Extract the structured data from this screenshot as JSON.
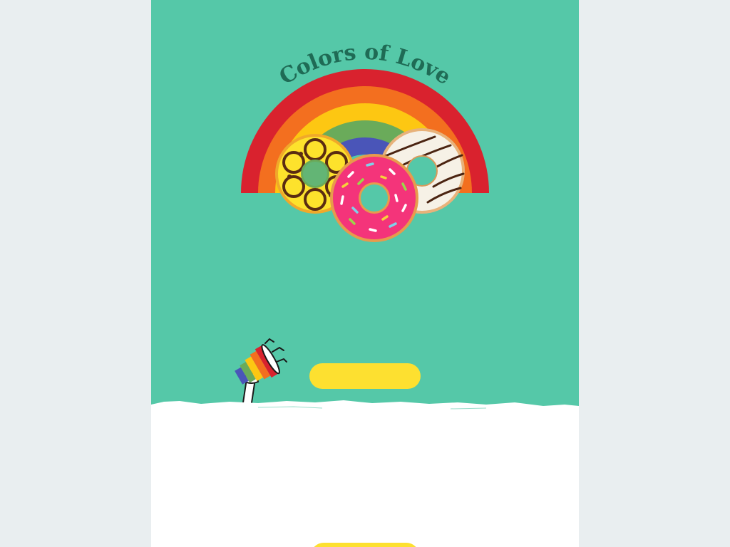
{
  "hero": {
    "title": "Colors of Love",
    "cta_label": ""
  },
  "footer": {
    "button_label": ""
  },
  "icons": {
    "rainbow": "rainbow-illustration",
    "donuts": [
      "yellow-flower-donut-icon",
      "pink-sprinkle-donut-icon",
      "white-striped-donut-icon"
    ],
    "megaphone": "rainbow-megaphone-icon"
  },
  "colors": {
    "hero_background": "#55c8a8",
    "title": "#1f6b55",
    "button": "#fde030",
    "page_background": "#e9eef0",
    "rainbow": [
      "#d9222e",
      "#f36f1f",
      "#fdc712",
      "#6aab5a",
      "#4a55b8"
    ]
  }
}
